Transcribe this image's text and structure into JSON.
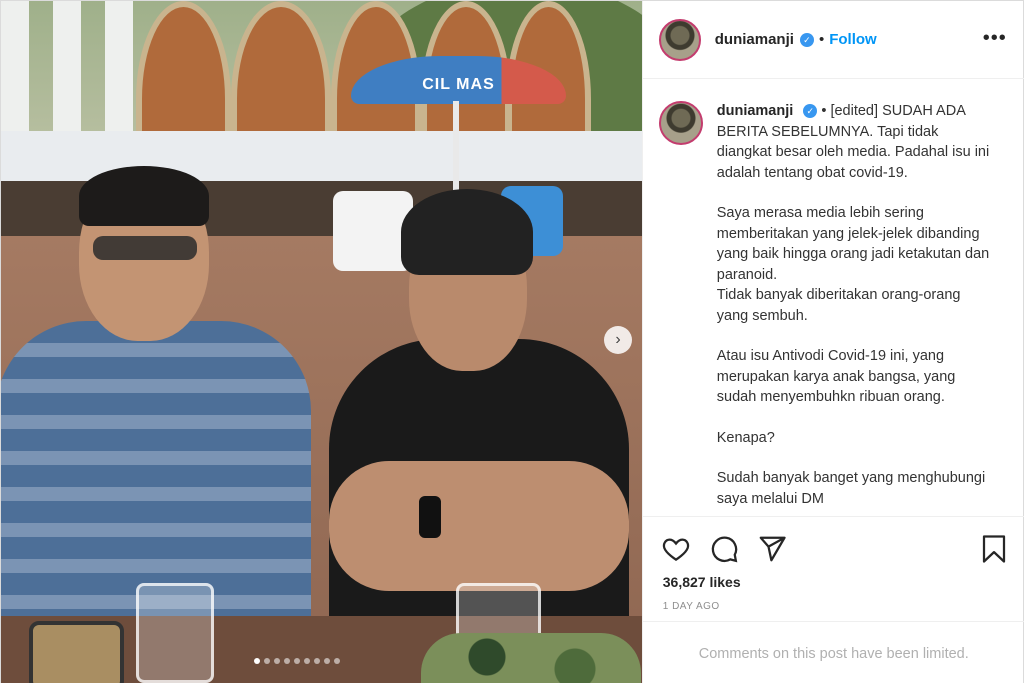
{
  "header": {
    "username": "duniamanji",
    "separator": "•",
    "follow_label": "Follow",
    "more_label": "•••"
  },
  "photo": {
    "umbrella_text": "CIL MAS",
    "next_label": "›",
    "carousel_dots": 9,
    "active_dot": 0
  },
  "caption": {
    "username": "duniamanji",
    "edited": "• [edited]",
    "paragraphs": [
      "SUDAH ADA BERITA SEBELUMNYA. Tapi tidak diangkat besar oleh media. Padahal isu ini adalah tentang obat covid-19.",
      "Saya merasa media lebih sering memberitakan yang jelek-jelek dibanding yang baik hingga orang jadi ketakutan dan paranoid.\nTidak banyak diberitakan orang-orang yang sembuh.",
      "Atau isu Antivodi Covid-19 ini, yang merupakan karya anak bangsa, yang sudah menyembuhkn ribuan orang.",
      "Kenapa?",
      "Sudah banyak banget yang menghubungi saya melalui DM"
    ]
  },
  "stats": {
    "likes_count": "36,827",
    "likes_label": "likes",
    "time": "1 DAY AGO"
  },
  "comments": {
    "limited_text": "Comments on this post have been limited."
  },
  "colors": {
    "accent": "#0095f6",
    "verified": "#3897f0",
    "muted": "#8e8e8e"
  }
}
